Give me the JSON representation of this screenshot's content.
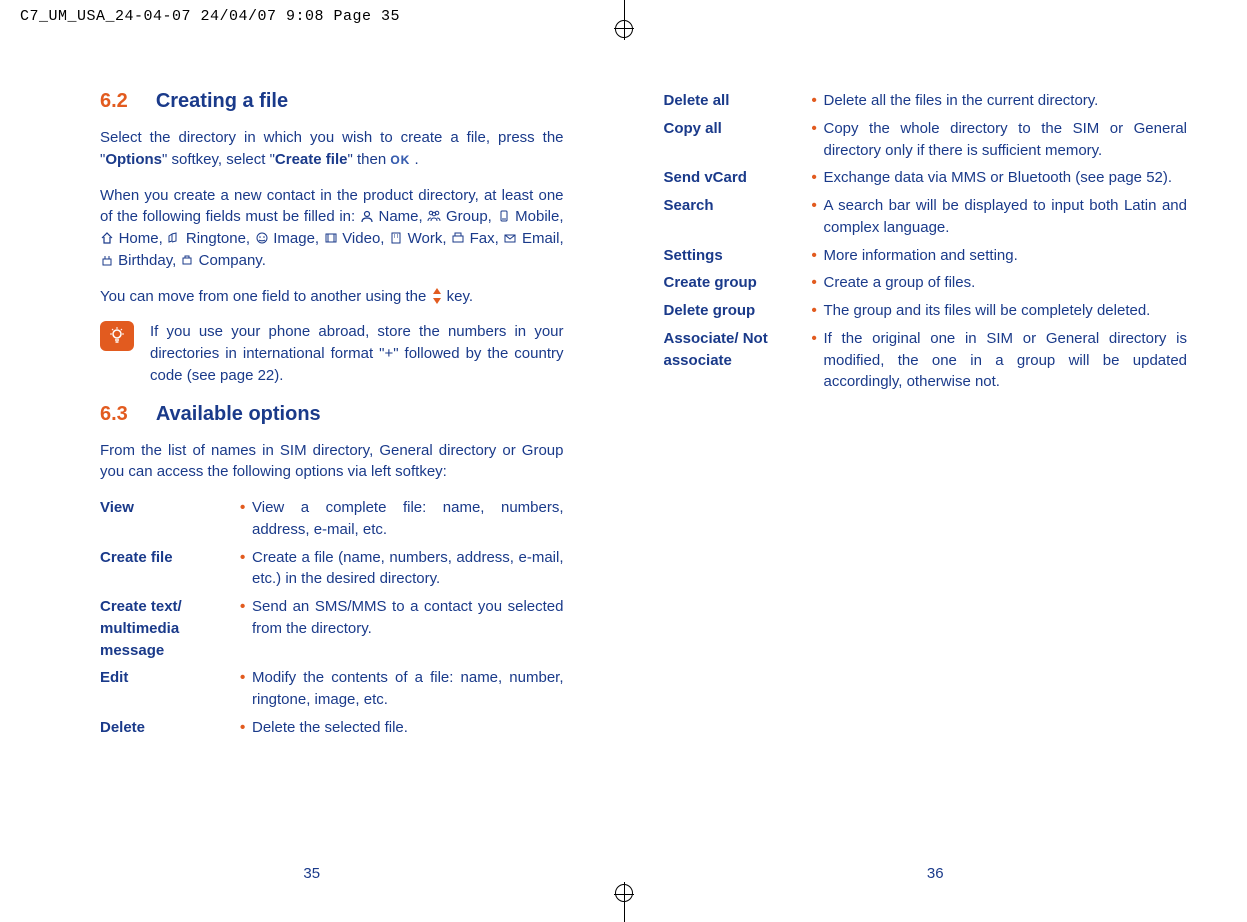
{
  "crop_info": "C7_UM_USA_24-04-07  24/04/07  9:08  Page 35",
  "left": {
    "page_num": "35",
    "h62": {
      "num": "6.2",
      "title": "Creating a file"
    },
    "p1_a": "Select the directory in which you wish to create a file, press the \"",
    "p1_b": "Options",
    "p1_c": "\" softkey, select \"",
    "p1_d": "Create file",
    "p1_e": "\" then ",
    "p1_ok": "OK",
    "p1_f": " .",
    "p2_lead": "When you create a new contact in the product directory, at least one of the following fields must be filled in: ",
    "fields": [
      "Name,",
      "Group,",
      "Mobile,",
      "Home,",
      "Ringtone,",
      "Image,",
      "Video,",
      "Work,",
      "Fax,",
      "Email,",
      "Birthday,",
      "Company."
    ],
    "p3_a": "You can move from one field to another using the ",
    "p3_b": " key.",
    "tip": "If you use your phone abroad, store the numbers in your directories in international format \"+\" followed by the country code (see page 22).",
    "h63": {
      "num": "6.3",
      "title": "Available options"
    },
    "p4": "From the list of names in SIM directory, General directory or Group you can access the following options via left softkey:",
    "options": [
      {
        "label": "View",
        "desc": "View a complete file: name, numbers, address, e-mail, etc."
      },
      {
        "label": "Create file",
        "desc": "Create a file (name, numbers, address, e-mail, etc.) in the desired directory."
      },
      {
        "label": "Create text/ multimedia message",
        "desc": "Send an SMS/MMS to a contact you selected from the directory."
      },
      {
        "label": "Edit",
        "desc": "Modify the contents of a file: name, number, ringtone, image, etc."
      },
      {
        "label": "Delete",
        "desc": "Delete the selected file."
      }
    ]
  },
  "right": {
    "page_num": "36",
    "options": [
      {
        "label": "Delete all",
        "desc": "Delete all the files in the current directory."
      },
      {
        "label": "Copy all",
        "desc": "Copy the whole directory to the SIM or General directory only if there is sufficient memory."
      },
      {
        "label": "Send vCard",
        "desc": "Exchange data via MMS or Bluetooth (see page 52)."
      },
      {
        "label": "Search",
        "desc": "A search bar will be displayed to input both Latin and complex language."
      },
      {
        "label": "Settings",
        "desc": "More information and setting."
      },
      {
        "label": "Create group",
        "desc": "Create a group of files."
      },
      {
        "label": "Delete group",
        "desc": "The group and its files will be completely deleted."
      },
      {
        "label": "Associate/ Not associate",
        "desc": "If the original one in SIM or General directory is modified, the one in a group will be updated accordingly, otherwise not."
      }
    ]
  }
}
